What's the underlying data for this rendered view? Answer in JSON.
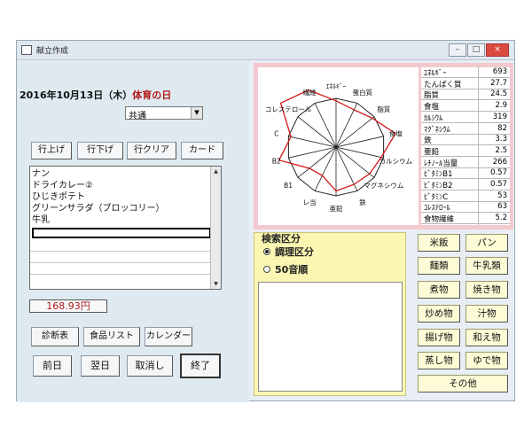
{
  "window": {
    "title": "献立作成",
    "minimize": "–",
    "maximize": "□",
    "close": "×"
  },
  "date": {
    "text": "2016年10月13日（木）",
    "label": "体育の日"
  },
  "combo": {
    "value": "共通",
    "arrow": "▼"
  },
  "row_buttons": [
    "行上げ",
    "行下げ",
    "行クリア",
    "カード"
  ],
  "menu_items": [
    "ナン",
    "ドライカレー②",
    "ひじきポテト",
    "グリーンサラダ（ブロッコリー）",
    "牛乳"
  ],
  "scroll": {
    "up": "▲",
    "down": "▼"
  },
  "price": "168.93円",
  "bottom_buttons": [
    "診断表",
    "食品リスト",
    "カレンダー"
  ],
  "nav_buttons": [
    "前日",
    "翌日",
    "取消し",
    "終了"
  ],
  "radar_labels": [
    "ｴﾈﾙｷﾞｰ",
    "蛋白質",
    "脂質",
    "食塩",
    "カルシウム",
    "マグネシウム",
    "鉄",
    "亜鉛",
    "レ当",
    "B1",
    "B2",
    "C",
    "コレステロール",
    "繊維"
  ],
  "nutrients": [
    {
      "name": "ｴﾈﾙｷﾞｰ",
      "value": "693"
    },
    {
      "name": "たんぱく質",
      "value": "27.7"
    },
    {
      "name": "脂質",
      "value": "24.5"
    },
    {
      "name": "食塩",
      "value": "2.9"
    },
    {
      "name": "ｶﾙｼｳﾑ",
      "value": "319"
    },
    {
      "name": "ﾏｸﾞﾈｼｳﾑ",
      "value": "82"
    },
    {
      "name": "鉄",
      "value": "3.3"
    },
    {
      "name": "亜鉛",
      "value": "2.5"
    },
    {
      "name": "ﾚﾁﾉｰﾙ当量",
      "value": "266"
    },
    {
      "name": "ﾋﾞﾀﾐﾝB1",
      "value": "0.57"
    },
    {
      "name": "ﾋﾞﾀﾐﾝB2",
      "value": "0.57"
    },
    {
      "name": "ﾋﾞﾀﾐﾝC",
      "value": "53"
    },
    {
      "name": "ｺﾚｽﾃﾛｰﾙ",
      "value": "63"
    },
    {
      "name": "食物繊維",
      "value": "5.2"
    }
  ],
  "radar_ratios": [
    0.95,
    0.85,
    0.95,
    1.25,
    0.95,
    0.88,
    0.85,
    0.9,
    0.65,
    0.7,
    1.2,
    0.95,
    1.45,
    1.3
  ],
  "search": {
    "label": "検索区分",
    "options": [
      {
        "label": "調理区分",
        "selected": true
      },
      {
        "label": "50音順",
        "selected": false
      }
    ]
  },
  "category_buttons": [
    "米飯",
    "パン",
    "麺類",
    "牛乳類",
    "煮物",
    "焼き物",
    "炒め物",
    "汁物",
    "揚げ物",
    "和え物",
    "蒸し物",
    "ゆで物"
  ],
  "other_button": "その他",
  "colors": {
    "chart_frame": "#f3c9cf",
    "radar_line": "#d01818",
    "search_bg": "#fbf7b2",
    "date_accent": "#b01818"
  }
}
